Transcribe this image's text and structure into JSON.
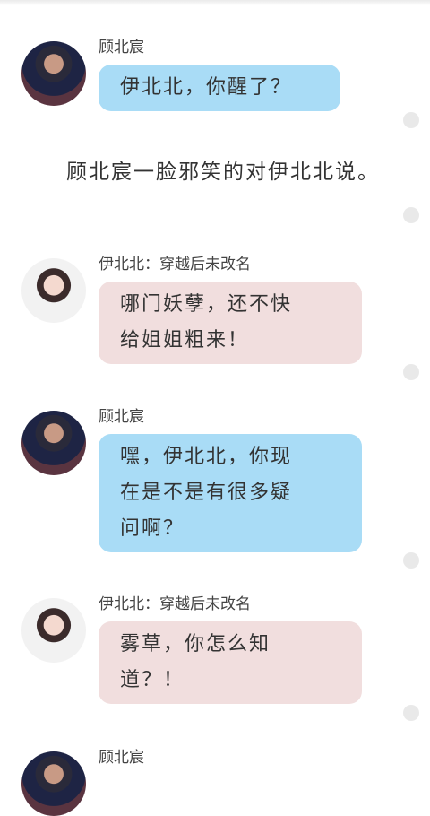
{
  "narration": "顾北宸一脸邪笑的对伊北北说。",
  "messages": [
    {
      "sender": "顾北宸",
      "text": "伊北北，你醒了？",
      "avatar": "boy-avatar",
      "bubble_color": "#a9dcf6"
    },
    {
      "sender": "伊北北：穿越后未改名",
      "line1": "哪门妖孽，还不快",
      "line2": "给姐姐粗来！",
      "avatar": "girl-avatar",
      "bubble_color": "#f1dede"
    },
    {
      "sender": "顾北宸",
      "line1": "嘿，伊北北，你现",
      "line2": "在是不是有很多疑",
      "line3": "问啊？",
      "avatar": "boy-avatar",
      "bubble_color": "#a9dcf6"
    },
    {
      "sender": "伊北北：穿越后未改名",
      "line1": "雾草，你怎么知",
      "line2": "道？！",
      "avatar": "girl-avatar",
      "bubble_color": "#f1dede"
    },
    {
      "sender": "顾北宸",
      "avatar": "boy-avatar"
    }
  ]
}
